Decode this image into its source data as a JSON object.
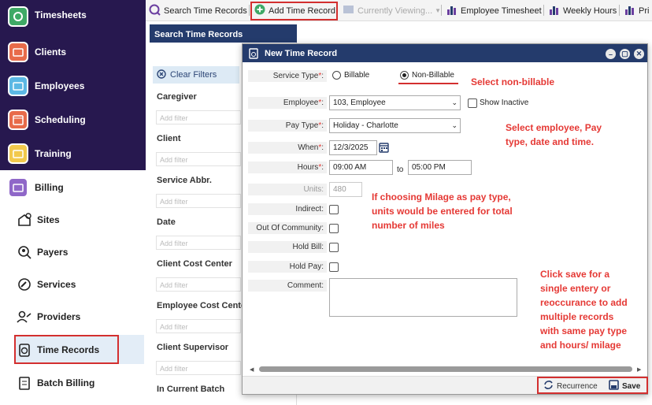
{
  "sidebar": {
    "main_items": [
      {
        "label": "Timesheets",
        "icon": "clock-icon",
        "color": "#3fa966"
      },
      {
        "label": "Clients",
        "icon": "folder-icon",
        "color": "#e86b4a"
      },
      {
        "label": "Employees",
        "icon": "folder-icon",
        "color": "#5cb8e4"
      },
      {
        "label": "Scheduling",
        "icon": "calendar-icon",
        "color": "#e86b4a"
      },
      {
        "label": "Training",
        "icon": "folder-icon",
        "color": "#f2c94c"
      }
    ],
    "billing": {
      "label": "Billing",
      "icon": "folder-icon",
      "color": "#8f67c8"
    },
    "sub_items": [
      {
        "label": "Sites",
        "icon": "sites-icon"
      },
      {
        "label": "Payers",
        "icon": "payers-icon"
      },
      {
        "label": "Services",
        "icon": "services-icon"
      },
      {
        "label": "Providers",
        "icon": "providers-icon"
      },
      {
        "label": "Time Records",
        "icon": "clipboard-clock-icon"
      },
      {
        "label": "Batch Billing",
        "icon": "batch-billing-icon"
      }
    ]
  },
  "toolbar": {
    "search": "Search Time Records",
    "add": "Add Time Record",
    "currently_viewing": "Currently Viewing...",
    "employee_timesheet": "Employee Timesheet",
    "weekly_hours": "Weekly Hours",
    "print": "Pri"
  },
  "search_panel": {
    "title": "Search Time Records",
    "clear_filters": "Clear Filters",
    "filter_placeholder": "Add filter",
    "filters": [
      "Caregiver",
      "Client",
      "Service Abbr.",
      "Date",
      "Client Cost Center",
      "Employee Cost Center",
      "Client Supervisor",
      "In Current Batch"
    ]
  },
  "modal": {
    "title": "New Time Record",
    "service_type_label": "Service Type",
    "billable": "Billable",
    "non_billable": "Non-Billable",
    "employee_label": "Employee",
    "employee_value": "103, Employee",
    "show_inactive": "Show Inactive",
    "pay_type_label": "Pay Type",
    "pay_type_value": "Holiday - Charlotte",
    "when_label": "When",
    "when_value": "12/3/2025",
    "hours_label": "Hours",
    "hours_from": "09:00 AM",
    "to": "to",
    "hours_to": "05:00 PM",
    "units_label": "Units:",
    "units_value": "480",
    "indirect_label": "Indirect:",
    "ooc_label": "Out Of Community:",
    "hold_bill_label": "Hold Bill:",
    "hold_pay_label": "Hold Pay:",
    "comment_label": "Comment:",
    "recurrence": "Recurrence",
    "save": "Save"
  },
  "annotations": {
    "select_non_billable": "Select non-billable",
    "select_employee": [
      "Select employee, Pay",
      "type, date and time."
    ],
    "milage": [
      "If choosing Milage as pay type,",
      "units would be entered for total",
      "number of miles"
    ],
    "save_note": [
      "Click save for a",
      "single entery or",
      "reoccurance to add",
      "multiple records",
      "with same pay type",
      "and hours/ milage"
    ]
  }
}
